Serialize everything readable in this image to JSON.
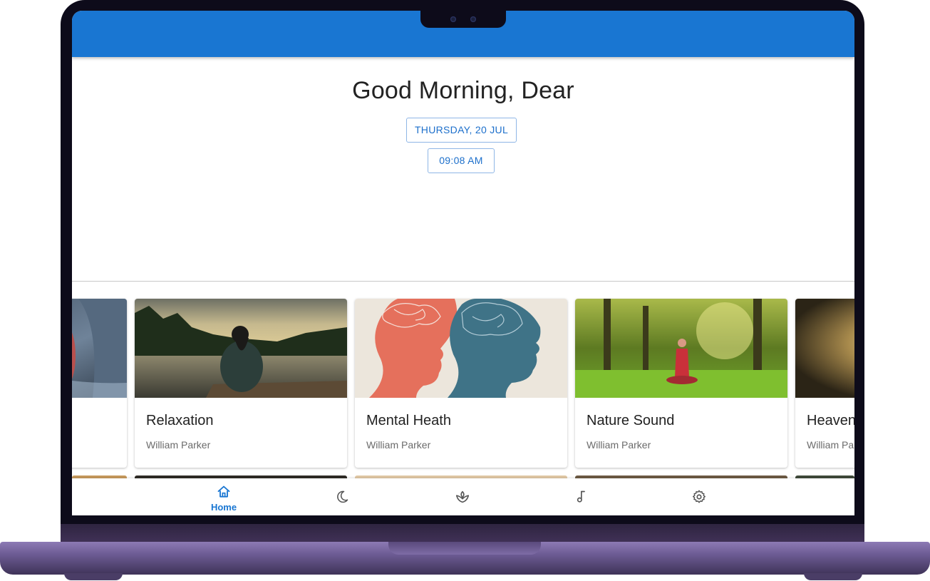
{
  "header": {
    "greeting": "Good Morning, Dear"
  },
  "date_chip": "THURSDAY, 20 JUL",
  "time_chip": "09:08 AM",
  "cards": [
    {
      "title": "",
      "author": ""
    },
    {
      "title": "Relaxation",
      "author": "William Parker"
    },
    {
      "title": "Mental Heath",
      "author": "William Parker"
    },
    {
      "title": "Nature Sound",
      "author": "William Parker"
    },
    {
      "title": "Heaven",
      "author": "William Pa"
    }
  ],
  "bottom_nav": {
    "items": [
      {
        "label": "Home",
        "icon": "home-icon",
        "active": true
      },
      {
        "label": "",
        "icon": "moon-icon",
        "active": false
      },
      {
        "label": "",
        "icon": "lotus-icon",
        "active": false
      },
      {
        "label": "",
        "icon": "music-note-icon",
        "active": false
      },
      {
        "label": "",
        "icon": "gear-icon",
        "active": false
      }
    ]
  },
  "colors": {
    "primary": "#1976d2",
    "chip_text": "#1c6fcb",
    "laptop_body": "#6b5a92"
  }
}
